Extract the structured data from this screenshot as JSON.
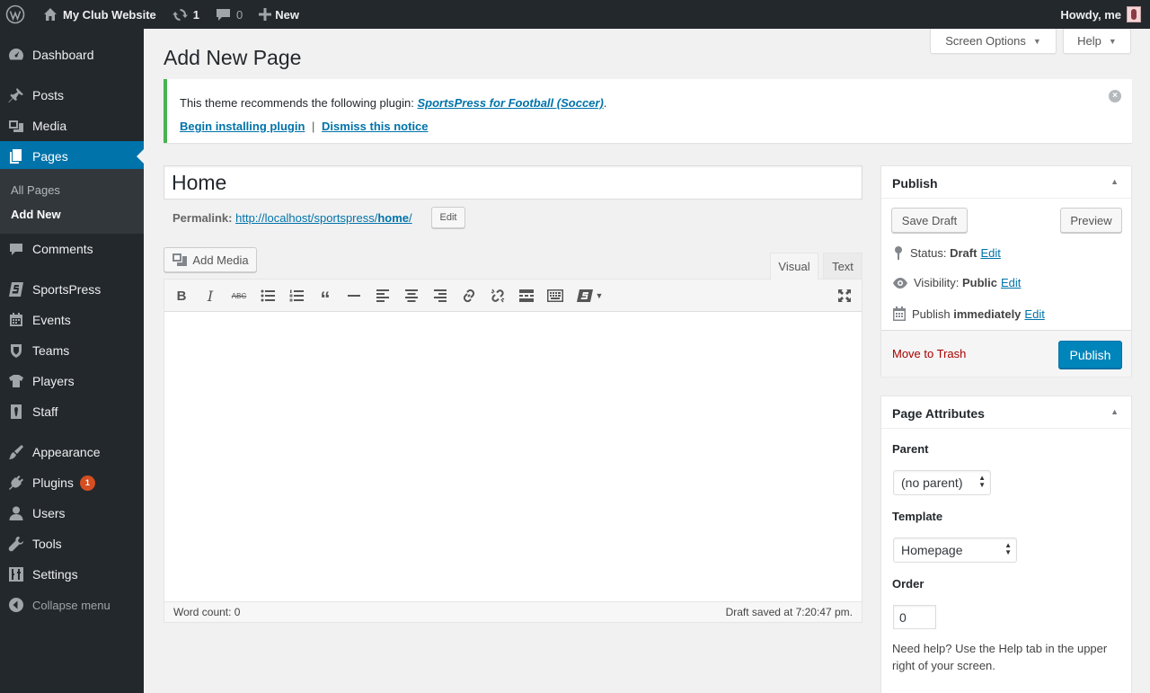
{
  "adminbar": {
    "site_name": "My Club Website",
    "updates_count": "1",
    "comments_count": "0",
    "new_label": "New",
    "howdy": "Howdy, me"
  },
  "sidebar": {
    "items": {
      "dashboard": "Dashboard",
      "posts": "Posts",
      "media": "Media",
      "pages": "Pages",
      "comments": "Comments",
      "sportspress": "SportsPress",
      "events": "Events",
      "teams": "Teams",
      "players": "Players",
      "staff": "Staff",
      "appearance": "Appearance",
      "plugins": "Plugins",
      "users": "Users",
      "tools": "Tools",
      "settings": "Settings",
      "collapse": "Collapse menu"
    },
    "pages_submenu": {
      "all": "All Pages",
      "add_new": "Add New"
    },
    "plugins_badge": "1"
  },
  "screen_options": {
    "screen_options_label": "Screen Options",
    "help_label": "Help"
  },
  "page": {
    "title": "Add New Page"
  },
  "notice": {
    "text": "This theme recommends the following plugin: ",
    "plugin_link": "SportsPress for Football (Soccer)",
    "period": ".",
    "install_link": "Begin installing plugin",
    "separator": "|",
    "dismiss_link": "Dismiss this notice"
  },
  "editor": {
    "title_value": "Home",
    "permalink_label": "Permalink:",
    "permalink_base": "http://localhost/sportspress/",
    "permalink_slug": "home",
    "permalink_trail": "/",
    "permalink_edit": "Edit",
    "add_media": "Add Media",
    "tab_visual": "Visual",
    "tab_text": "Text",
    "word_count": "Word count: 0",
    "draft_saved": "Draft saved at 7:20:47 pm."
  },
  "publish_box": {
    "title": "Publish",
    "save_draft": "Save Draft",
    "preview": "Preview",
    "status_label": "Status:",
    "status_value": "Draft",
    "visibility_label": "Visibility:",
    "visibility_value": "Public",
    "publish_label": "Publish",
    "publish_value": "immediately",
    "edit": "Edit",
    "trash": "Move to Trash",
    "publish_button": "Publish"
  },
  "attributes_box": {
    "title": "Page Attributes",
    "parent_label": "Parent",
    "parent_value": "(no parent)",
    "template_label": "Template",
    "template_value": "Homepage",
    "order_label": "Order",
    "order_value": "0",
    "help_text": "Need help? Use the Help tab in the upper right of your screen."
  },
  "colors": {
    "admin_dark": "#23282d",
    "accent": "#0073aa",
    "notice_success": "#46b450",
    "trash_red": "#a00000",
    "badge": "#d54e21"
  }
}
